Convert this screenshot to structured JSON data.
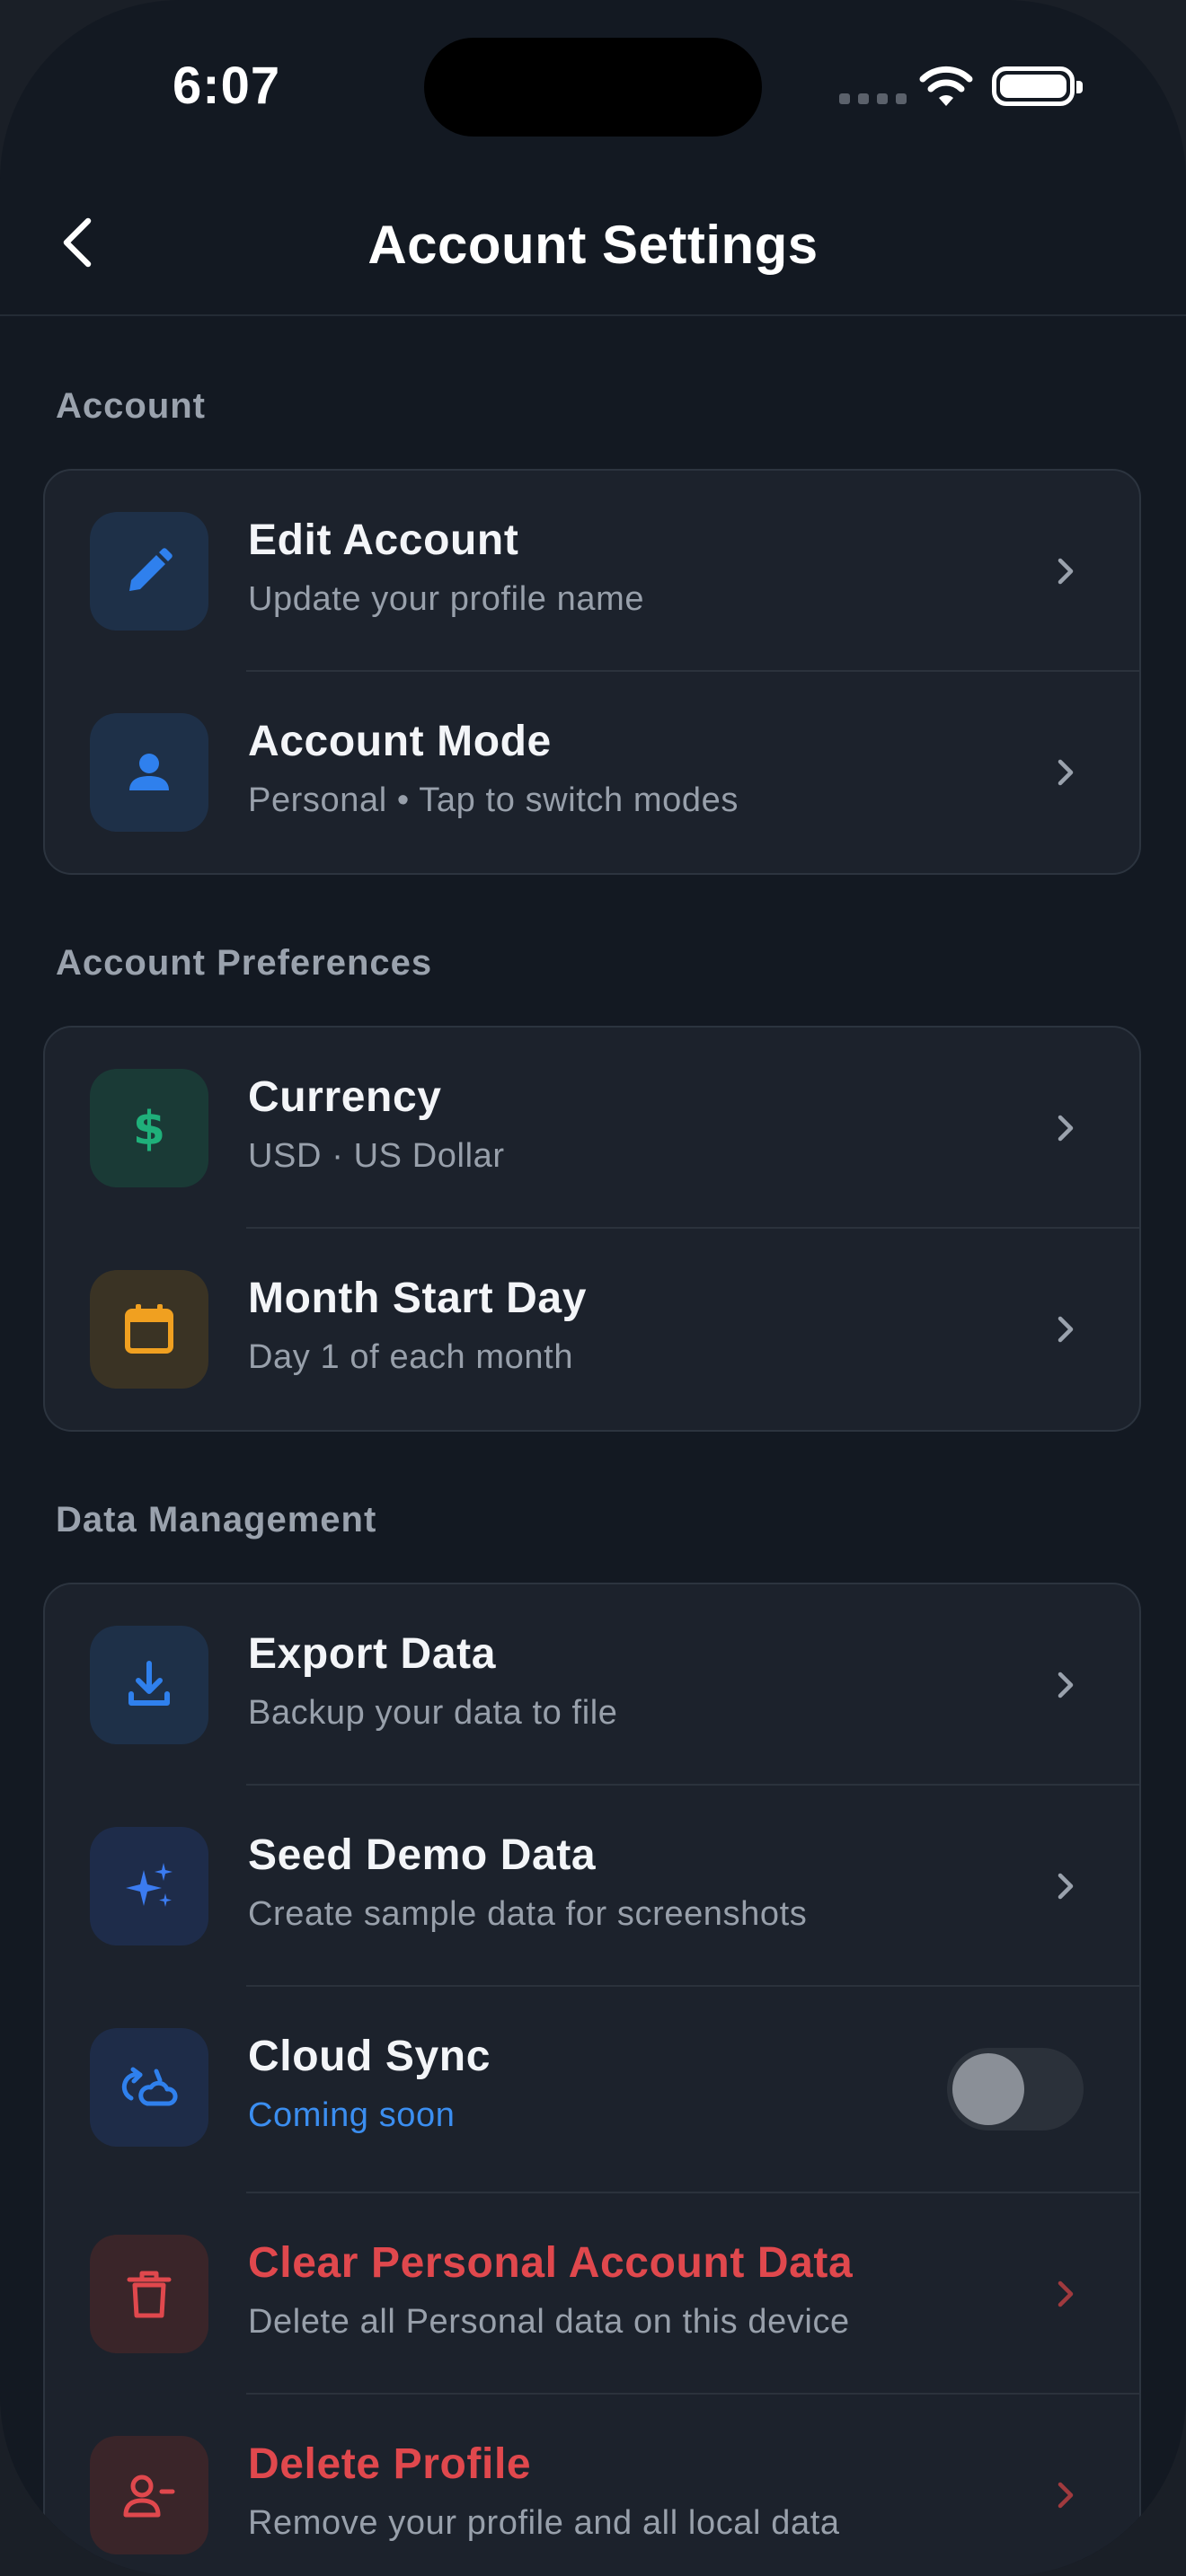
{
  "status_bar": {
    "time": "6:07"
  },
  "header": {
    "title": "Account Settings"
  },
  "sections": [
    {
      "label": "Account",
      "items": [
        {
          "title": "Edit Account",
          "subtitle": "Update your profile name",
          "icon": "pencil-icon"
        },
        {
          "title": "Account Mode",
          "subtitle": "Personal • Tap to switch modes",
          "icon": "person-icon"
        }
      ]
    },
    {
      "label": "Account Preferences",
      "items": [
        {
          "title": "Currency",
          "subtitle": "USD · US Dollar",
          "icon": "dollar-icon"
        },
        {
          "title": "Month Start Day",
          "subtitle": "Day 1 of each month",
          "icon": "calendar-icon"
        }
      ]
    },
    {
      "label": "Data Management",
      "items": [
        {
          "title": "Export Data",
          "subtitle": "Backup your data to file",
          "icon": "download-icon"
        },
        {
          "title": "Seed Demo Data",
          "subtitle": "Create sample data for screenshots",
          "icon": "sparkles-icon"
        },
        {
          "title": "Cloud Sync",
          "subtitle": "Coming soon",
          "icon": "cloud-sync-icon",
          "toggle_on": false
        },
        {
          "title": "Clear Personal Account Data",
          "subtitle": "Delete all Personal data on this device",
          "icon": "trash-icon"
        },
        {
          "title": "Delete Profile",
          "subtitle": "Remove your profile and all local data",
          "icon": "person-minus-icon"
        }
      ]
    }
  ],
  "colors": {
    "background": "#131922",
    "card": "#1c222c",
    "accent_blue": "#2f80ed",
    "green": "#1fb07a",
    "orange": "#f0a020",
    "danger": "#e0484d"
  }
}
